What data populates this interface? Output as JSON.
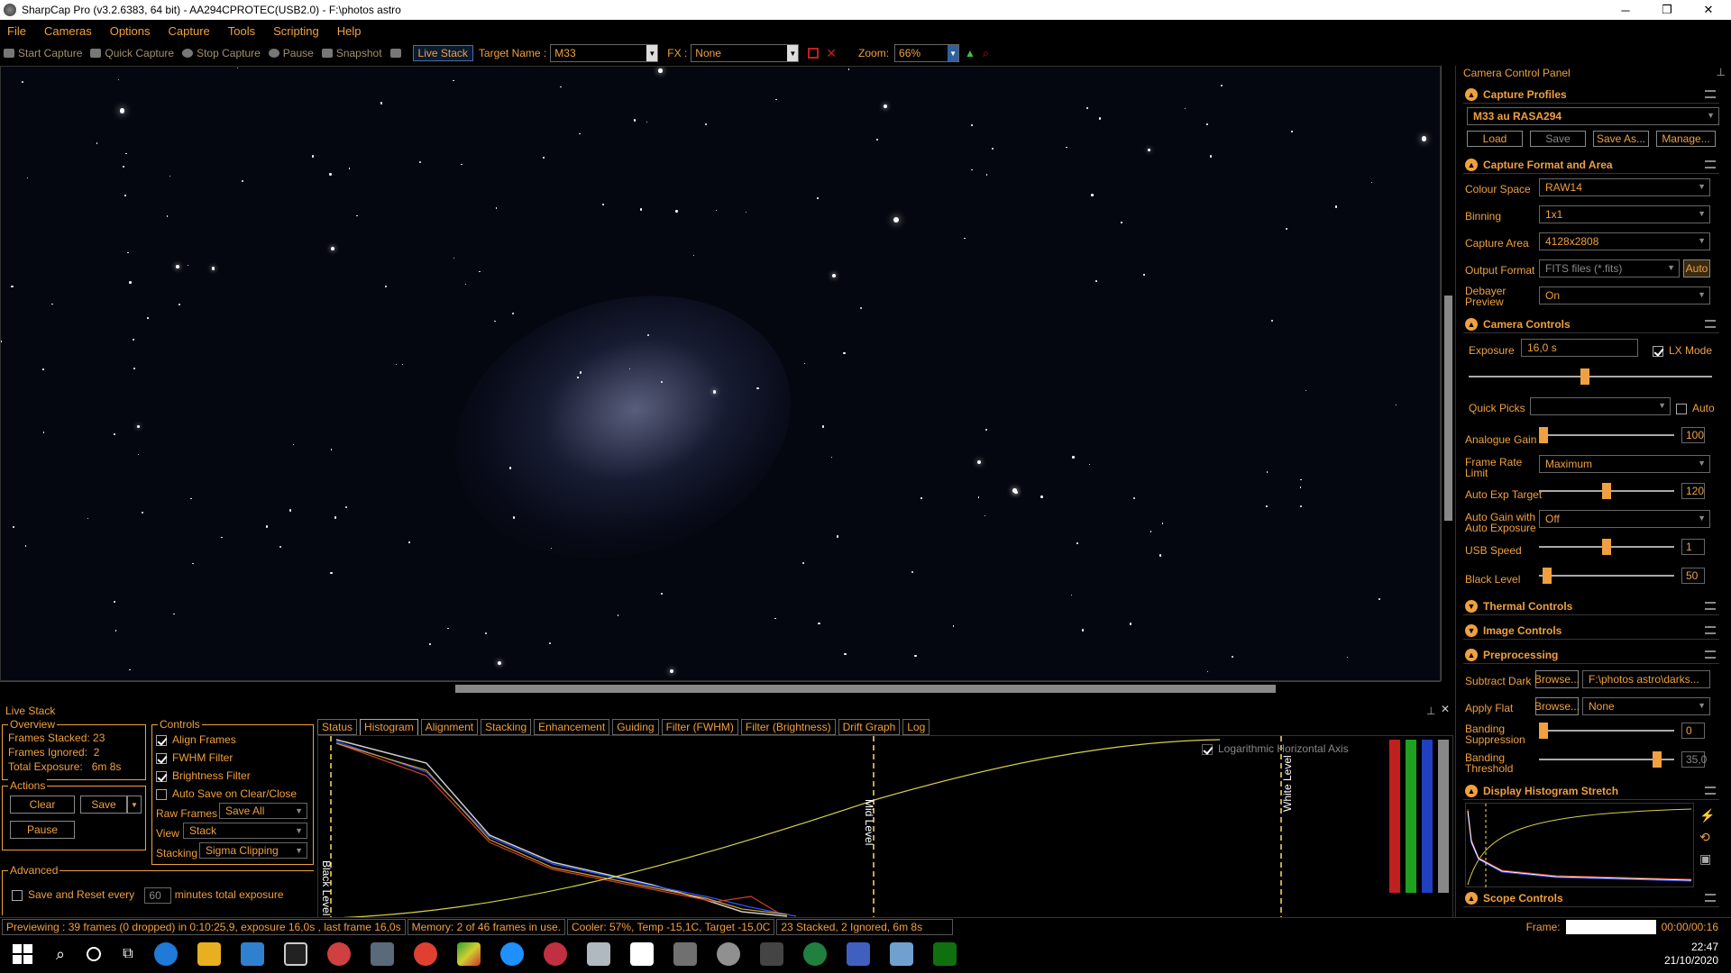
{
  "window": {
    "title": "SharpCap Pro (v3.2.6383, 64 bit) - AA294CPROTEC(USB2.0) - F:\\photos astro",
    "minimize": "─",
    "maximize": "❐",
    "close": "✕"
  },
  "menu": [
    "File",
    "Cameras",
    "Options",
    "Capture",
    "Tools",
    "Scripting",
    "Help"
  ],
  "toolbar": {
    "start_capture": "Start Capture",
    "quick_capture": "Quick Capture",
    "stop_capture": "Stop Capture",
    "pause": "Pause",
    "snapshot": "Snapshot",
    "live_stack": "Live Stack",
    "target_name_label": "Target Name :",
    "target_name": "M33",
    "fx_label": "FX :",
    "fx": "None",
    "zoom_label": "Zoom:",
    "zoom": "66%"
  },
  "live_stack": {
    "title": "Live Stack",
    "overview": {
      "title": "Overview",
      "frames_stacked_label": "Frames Stacked:",
      "frames_stacked": "23",
      "frames_ignored_label": "Frames Ignored:",
      "frames_ignored": "2",
      "total_exposure_label": "Total Exposure:",
      "total_exposure": "6m 8s"
    },
    "actions": {
      "title": "Actions",
      "clear": "Clear",
      "save": "Save",
      "pause": "Pause"
    },
    "advanced": {
      "title": "Advanced",
      "save_reset_label": "Save and Reset every",
      "minutes": "60",
      "minutes_suffix": "minutes total exposure"
    },
    "controls": {
      "title": "Controls",
      "align_frames": "Align Frames",
      "fwhm_filter": "FWHM Filter",
      "brightness_filter": "Brightness Filter",
      "auto_save": "Auto Save on Clear/Close",
      "raw_frames_label": "Raw Frames",
      "raw_frames": "Save All",
      "view_label": "View",
      "view": "Stack",
      "stacking_label": "Stacking",
      "stacking": "Sigma Clipping"
    },
    "tabs": [
      "Status",
      "Histogram",
      "Alignment",
      "Stacking",
      "Enhancement",
      "Guiding",
      "Filter (FWHM)",
      "Filter (Brightness)",
      "Drift Graph",
      "Log"
    ],
    "active_tab": "Histogram",
    "histogram": {
      "log_axis_label": "Logarithmic Horizontal Axis",
      "black_level": "Black Level",
      "mid_level": "Mid Level",
      "white_level": "White Level"
    }
  },
  "panel": {
    "title": "Camera Control Panel",
    "capture_profiles": {
      "title": "Capture Profiles",
      "profile": "M33 au RASA294",
      "load": "Load",
      "save": "Save",
      "save_as": "Save As...",
      "manage": "Manage..."
    },
    "format": {
      "title": "Capture Format and Area",
      "colour_space_label": "Colour Space",
      "colour_space": "RAW14",
      "binning_label": "Binning",
      "binning": "1x1",
      "capture_area_label": "Capture Area",
      "capture_area": "4128x2808",
      "output_format_label": "Output Format",
      "output_format": "FITS files (*.fits)",
      "auto": "Auto",
      "debayer_label_1": "Debayer",
      "debayer_label_2": "Preview",
      "debayer": "On"
    },
    "camera_controls": {
      "title": "Camera Controls",
      "exposure_label": "Exposure",
      "exposure": "16,0 s",
      "lx_mode": "LX Mode",
      "quick_picks_label": "Quick Picks",
      "auto": "Auto",
      "analogue_gain_label": "Analogue Gain",
      "analogue_gain": "100",
      "frame_rate_label_1": "Frame Rate",
      "frame_rate_label_2": "Limit",
      "frame_rate": "Maximum",
      "auto_exp_target_label": "Auto Exp Target",
      "auto_exp_target": "120",
      "auto_gain_label_1": "Auto Gain with",
      "auto_gain_label_2": "Auto Exposure",
      "auto_gain": "Off",
      "usb_speed_label": "USB Speed",
      "usb_speed": "1",
      "black_level_label": "Black Level",
      "black_level": "50"
    },
    "thermal": {
      "title": "Thermal Controls"
    },
    "image": {
      "title": "Image Controls"
    },
    "preprocessing": {
      "title": "Preprocessing",
      "subtract_dark_label": "Subtract Dark",
      "browse": "Browse...",
      "dark_path": "F:\\photos astro\\darks...",
      "apply_flat_label": "Apply Flat",
      "flat": "None",
      "banding_supp_label_1": "Banding",
      "banding_supp_label_2": "Suppression",
      "banding_supp": "0",
      "banding_thresh_label_1": "Banding",
      "banding_thresh_label_2": "Threshold",
      "banding_thresh": "35,0"
    },
    "display_histogram": {
      "title": "Display Histogram Stretch"
    },
    "scope": {
      "title": "Scope Controls"
    }
  },
  "status": {
    "previewing": "Previewing : 39 frames (0 dropped) in 0:10:25,9, exposure 16,0s , last frame 16,0s",
    "memory": "Memory: 2 of 46 frames in use.",
    "cooler": "Cooler: 57%, Temp -15,1C, Target -15,0C",
    "stacked": "23 Stacked, 2 Ignored, 6m 8s",
    "frame_label": "Frame:",
    "elapsed": "00:00/00:16"
  },
  "taskbar": {
    "time": "22:47",
    "date": "21/10/2020"
  }
}
